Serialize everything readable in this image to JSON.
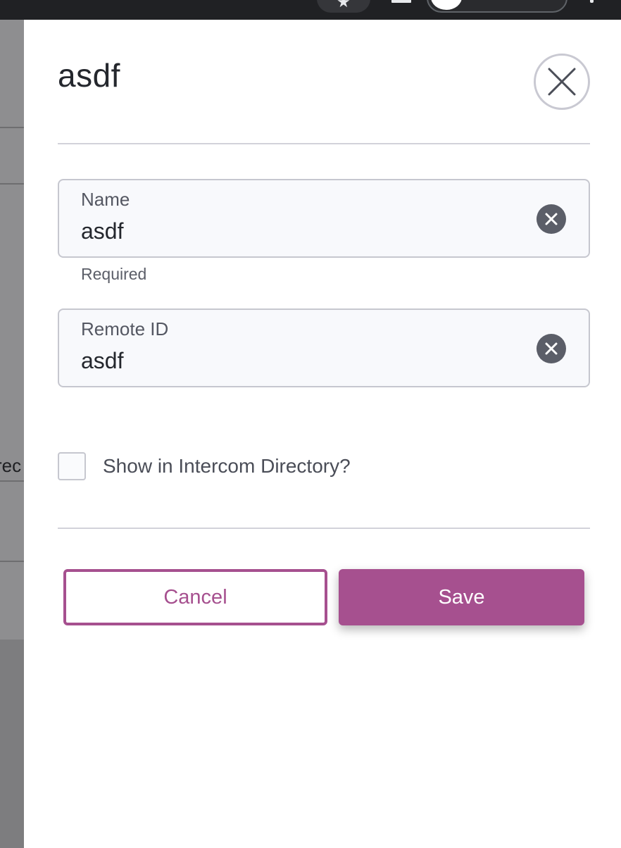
{
  "drawer": {
    "title": "asdf",
    "close_icon": "close-icon"
  },
  "background": {
    "partial_text": "rec"
  },
  "fields": {
    "name": {
      "label": "Name",
      "value": "asdf",
      "helper": "Required",
      "clear_icon": "clear-icon"
    },
    "remote_id": {
      "label": "Remote ID",
      "value": "asdf",
      "clear_icon": "clear-icon"
    }
  },
  "checkbox": {
    "label": "Show in Intercom Directory?",
    "checked": false
  },
  "actions": {
    "cancel_label": "Cancel",
    "save_label": "Save"
  },
  "colors": {
    "accent": "#a6508f",
    "clear_icon_bg": "#5b5e68",
    "field_border": "#c6c7cf"
  }
}
